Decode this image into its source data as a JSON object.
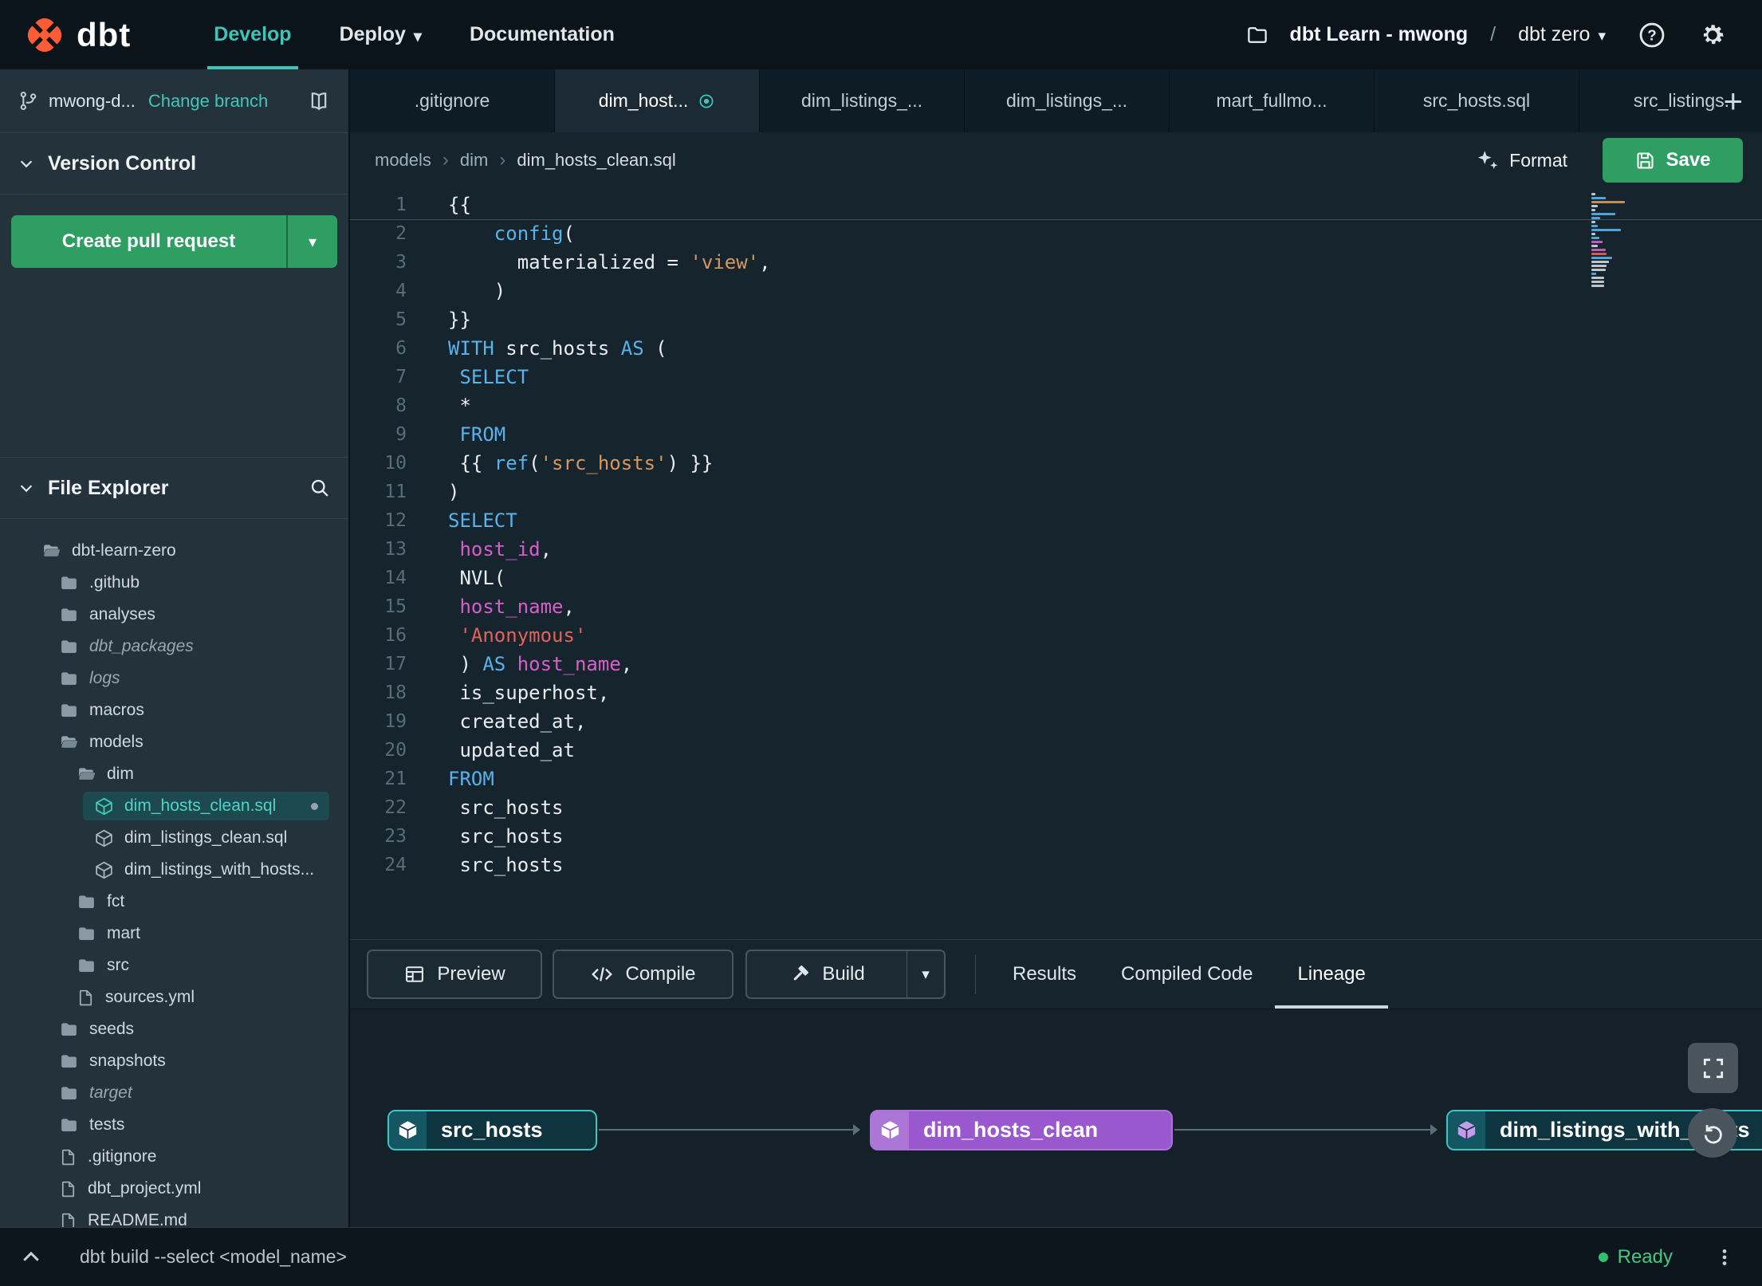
{
  "colors": {
    "accent_teal": "#3fc5b7",
    "brand_orange": "#ff5c35",
    "button_green": "#2f9e63",
    "node_purple": "#9a58ce",
    "node_teal_border": "#3fc4c4",
    "status_green": "#44c783",
    "syntax_keyword": "#58b3ea",
    "syntax_string": "#d7985f",
    "syntax_string_alt": "#e2635c",
    "syntax_identifier": "#d65fc9"
  },
  "navbar": {
    "brand": "dbt",
    "items": [
      {
        "label": "Develop",
        "active": true,
        "chevron": false
      },
      {
        "label": "Deploy",
        "active": false,
        "chevron": true
      },
      {
        "label": "Documentation",
        "active": false,
        "chevron": false
      }
    ],
    "project": "dbt Learn - mwong",
    "separator": "/",
    "environment": "dbt zero"
  },
  "sidebar": {
    "branch_name": "mwong-d...",
    "change_branch_label": "Change branch",
    "version_control_title": "Version Control",
    "create_pr_label": "Create pull request",
    "file_explorer_title": "File Explorer",
    "tree": [
      {
        "label": "dbt-learn-zero",
        "type": "folder-open",
        "depth": 0
      },
      {
        "label": ".github",
        "type": "folder",
        "depth": 1
      },
      {
        "label": "analyses",
        "type": "folder",
        "depth": 1
      },
      {
        "label": "dbt_packages",
        "type": "folder",
        "depth": 1,
        "italic": true
      },
      {
        "label": "logs",
        "type": "folder",
        "depth": 1,
        "italic": true
      },
      {
        "label": "macros",
        "type": "folder",
        "depth": 1
      },
      {
        "label": "models",
        "type": "folder-open",
        "depth": 1
      },
      {
        "label": "dim",
        "type": "folder-open",
        "depth": 2
      },
      {
        "label": "dim_hosts_clean.sql",
        "type": "model",
        "depth": 3,
        "selected": true,
        "modified": true
      },
      {
        "label": "dim_listings_clean.sql",
        "type": "model",
        "depth": 3
      },
      {
        "label": "dim_listings_with_hosts...",
        "type": "model",
        "depth": 3
      },
      {
        "label": "fct",
        "type": "folder",
        "depth": 2
      },
      {
        "label": "mart",
        "type": "folder",
        "depth": 2
      },
      {
        "label": "src",
        "type": "folder",
        "depth": 2
      },
      {
        "label": "sources.yml",
        "type": "file",
        "depth": 2
      },
      {
        "label": "seeds",
        "type": "folder",
        "depth": 1
      },
      {
        "label": "snapshots",
        "type": "folder",
        "depth": 1
      },
      {
        "label": "target",
        "type": "folder",
        "depth": 1,
        "italic": true
      },
      {
        "label": "tests",
        "type": "folder",
        "depth": 1
      },
      {
        "label": ".gitignore",
        "type": "file",
        "depth": 1
      },
      {
        "label": "dbt_project.yml",
        "type": "file",
        "depth": 1
      },
      {
        "label": "README.md",
        "type": "file",
        "depth": 1
      }
    ]
  },
  "tabs": {
    "items": [
      {
        "label": ".gitignore"
      },
      {
        "label": "dim_host...",
        "active": true,
        "modified": true
      },
      {
        "label": "dim_listings_..."
      },
      {
        "label": "dim_listings_..."
      },
      {
        "label": "mart_fullmo..."
      },
      {
        "label": "src_hosts.sql"
      },
      {
        "label": "src_listings."
      }
    ],
    "add_label": "+"
  },
  "editor": {
    "breadcrumb": [
      "models",
      "dim",
      "dim_hosts_clean.sql"
    ],
    "format_label": "Format",
    "save_label": "Save",
    "code_lines": [
      [
        [
          "p",
          "{{"
        ]
      ],
      [
        [
          "p",
          "    "
        ],
        [
          "kw",
          "config"
        ],
        [
          "p",
          "("
        ]
      ],
      [
        [
          "p",
          "      materialized = "
        ],
        [
          "str",
          "'view'"
        ],
        [
          "p",
          ","
        ]
      ],
      [
        [
          "p",
          "    )"
        ]
      ],
      [
        [
          "p",
          "}}"
        ]
      ],
      [
        [
          "kw",
          "WITH"
        ],
        [
          "p",
          " src_hosts "
        ],
        [
          "kw",
          "AS"
        ],
        [
          "p",
          " ("
        ]
      ],
      [
        [
          "p",
          " "
        ],
        [
          "kw",
          "SELECT"
        ]
      ],
      [
        [
          "p",
          " *"
        ]
      ],
      [
        [
          "p",
          " "
        ],
        [
          "kw",
          "FROM"
        ]
      ],
      [
        [
          "p",
          " {{ "
        ],
        [
          "kw",
          "ref"
        ],
        [
          "p",
          "("
        ],
        [
          "str",
          "'src_hosts'"
        ],
        [
          "p",
          ") }}"
        ]
      ],
      [
        [
          "p",
          ")"
        ]
      ],
      [
        [
          "kw",
          "SELECT"
        ]
      ],
      [
        [
          "p",
          " "
        ],
        [
          "id",
          "host_id"
        ],
        [
          "p",
          ","
        ]
      ],
      [
        [
          "p",
          " NVL("
        ]
      ],
      [
        [
          "p",
          " "
        ],
        [
          "id",
          "host_name"
        ],
        [
          "p",
          ","
        ]
      ],
      [
        [
          "p",
          " "
        ],
        [
          "str2",
          "'Anonymous'"
        ]
      ],
      [
        [
          "p",
          " ) "
        ],
        [
          "kw",
          "AS"
        ],
        [
          "p",
          " "
        ],
        [
          "id",
          "host_name"
        ],
        [
          "p",
          ","
        ]
      ],
      [
        [
          "p",
          " is_superhost,"
        ]
      ],
      [
        [
          "p",
          " created_at,"
        ]
      ],
      [
        [
          "p",
          " updated_at"
        ]
      ],
      [
        [
          "kw",
          "FROM"
        ]
      ],
      [
        [
          "p",
          " src_hosts"
        ]
      ],
      [
        [
          "p",
          " src_hosts"
        ]
      ],
      [
        [
          "p",
          " src_hosts"
        ]
      ]
    ]
  },
  "panel": {
    "preview_label": "Preview",
    "compile_label": "Compile",
    "build_label": "Build",
    "tabs": [
      {
        "label": "Results"
      },
      {
        "label": "Compiled Code"
      },
      {
        "label": "Lineage",
        "active": true
      }
    ],
    "lineage_nodes": [
      {
        "label": "src_hosts",
        "style": "teal"
      },
      {
        "label": "dim_hosts_clean",
        "style": "purple"
      },
      {
        "label": "dim_listings_with_hosts",
        "style": "teal"
      }
    ]
  },
  "statusbar": {
    "command": "dbt build --select <model_name>",
    "status": "Ready"
  }
}
